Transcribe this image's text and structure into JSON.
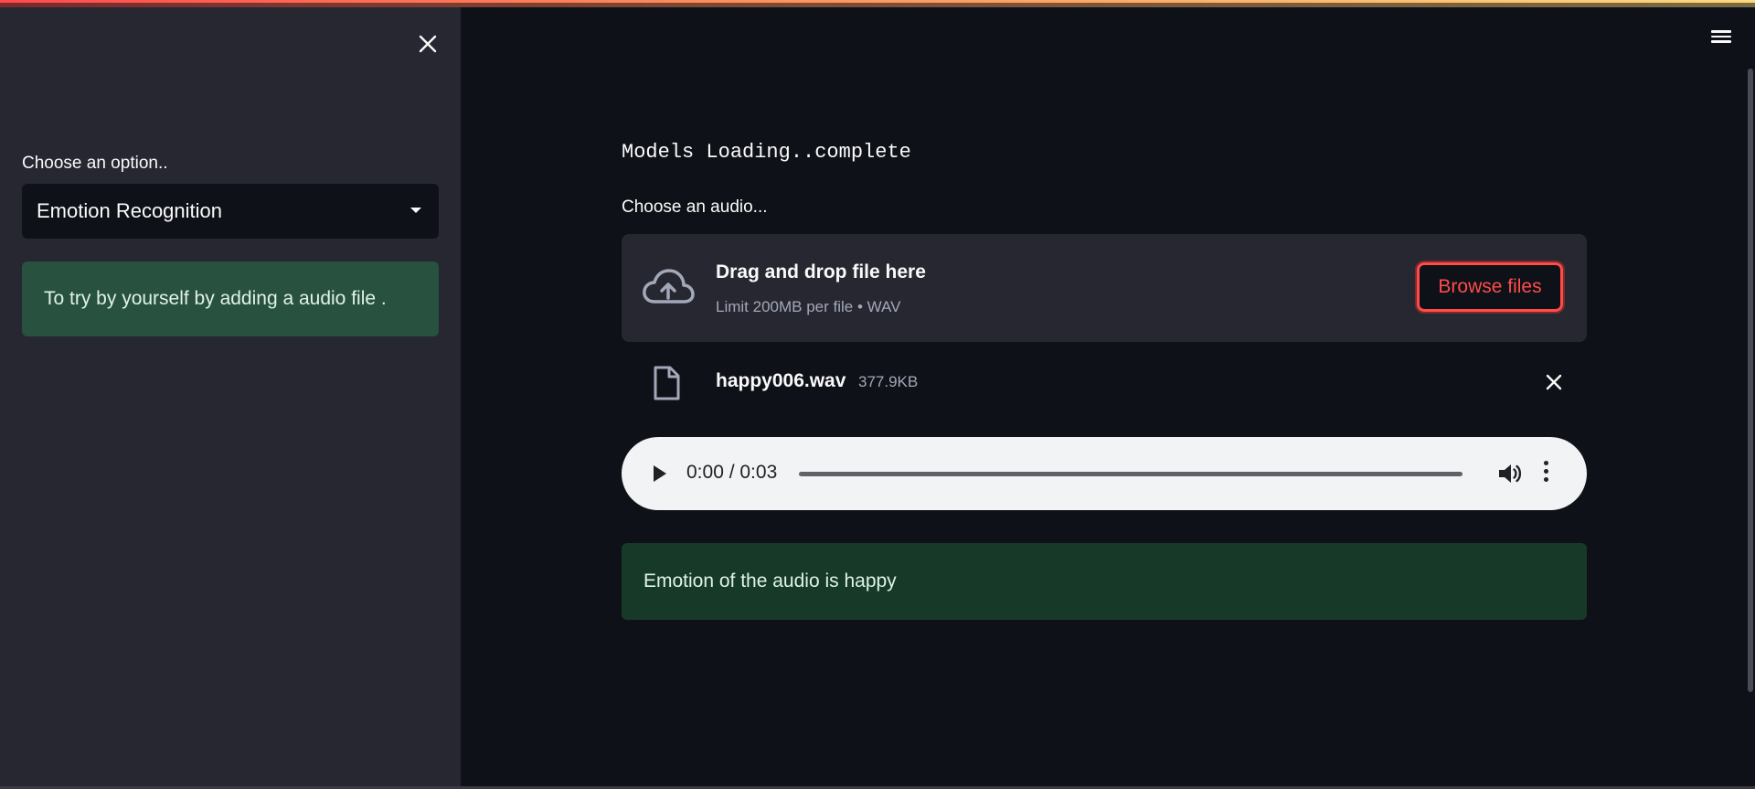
{
  "sidebar": {
    "option_label": "Choose an option..",
    "select_value": "Emotion Recognition",
    "info_text": "To try by yourself by adding a audio file ."
  },
  "main": {
    "status_line": "Models Loading..complete",
    "audio_label": "Choose an audio...",
    "uploader": {
      "title": "Drag and drop file here",
      "subtitle": "Limit 200MB per file • WAV",
      "browse_label": "Browse files"
    },
    "file": {
      "name": "happy006.wav",
      "size": "377.9KB"
    },
    "player": {
      "time": "0:00 / 0:03",
      "progress": 0
    },
    "result_text": "Emotion of the audio is happy"
  },
  "colors": {
    "accent": "#ff4b4b",
    "sidebar_bg": "#262730",
    "app_bg": "#0e1117",
    "success_bg": "#173928"
  },
  "icons": [
    "close-icon",
    "chevron-down-icon",
    "menu-icon",
    "cloud-upload-icon",
    "file-icon",
    "play-icon",
    "volume-icon",
    "more-vert-icon"
  ]
}
